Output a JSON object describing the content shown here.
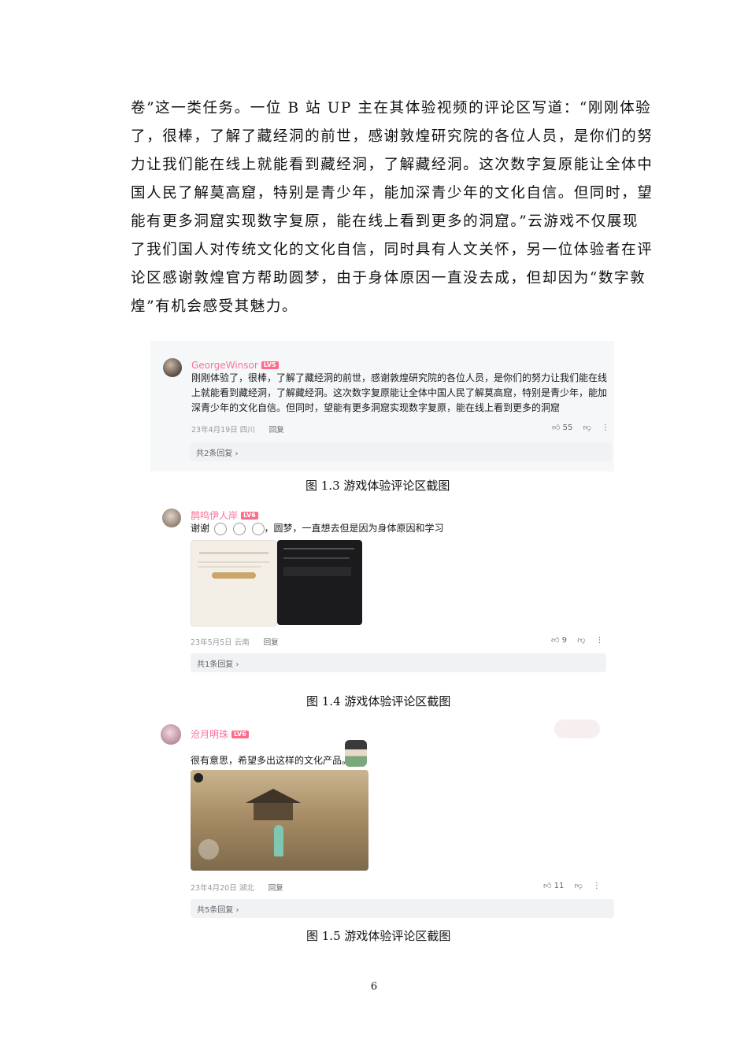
{
  "body_text": {
    "lines": [
      "卷”这一类任务。一位 B 站 UP 主在其体验视频的评论区写道：“刚刚体验",
      "了，很棒，了解了藏经洞的前世，感谢敦煌研究院的各位人员，是你们的努",
      "力让我们能在线上就能看到藏经洞，了解藏经洞。这次数字复原能让全体中",
      "国人民了解莫高窟，特别是青少年，能加深青少年的文化自信。但同时，望",
      "能有更多洞窟实现数字复原，能在线上看到更多的洞窟。”云游戏不仅展现",
      "了我们国人对传统文化的文化自信，同时具有人文关怀，另一位体验者在评",
      "论区感谢敦煌官方帮助圆梦，由于身体原因一直没去成，但却因为“数字敦",
      "煌”有机会感受其魅力。"
    ]
  },
  "figures": [
    {
      "caption": "图 1.3  游戏体验评论区截图",
      "username": "GeorgeWinsor",
      "level": "LV5",
      "comment_lines": [
        "刚刚体验了，很棒，了解了藏经洞的前世，感谢敦煌研究院的各位人员，是你们的努力让我们能在线",
        "上就能看到藏经洞，了解藏经洞。这次数字复原能让全体中国人民了解莫高窟，特别是青少年，能加",
        "深青少年的文化自信。但同时，望能有更多洞窟实现数字复原，能在线上看到更多的洞窟"
      ],
      "date": "23年4月19日 四川",
      "reply_label": "回复",
      "likes": "55",
      "replies_label": "共2条回复 ›"
    },
    {
      "caption": "图 1.4 游戏体验评论区截图",
      "username": "鹊鸣伊人岸",
      "level": "LV6",
      "comment_prefix": "谢谢",
      "comment_suffix": "，圆梦，一直想去但是因为身体原因和学习",
      "date": "23年5月5日 云南",
      "reply_label": "回复",
      "likes": "9",
      "replies_label": "共1条回复 ›"
    },
    {
      "caption": "图 1.5 游戏体验评论区截图",
      "username": "沧月明珠",
      "level": "LV6",
      "comment": "很有意思，希望多出这样的文化产品。",
      "date": "23年4月20日 湖北",
      "reply_label": "回复",
      "likes": "11",
      "replies_label": "共5条回复 ›"
    }
  ],
  "page_number": "6",
  "colors": {
    "username": "#fb7299",
    "level_badge": "#ff6b8a",
    "meta": "#9499a0",
    "reply_box": "#f1f2f3"
  }
}
